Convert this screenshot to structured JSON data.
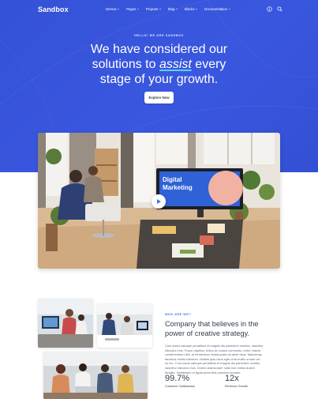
{
  "nav": {
    "logo": "Sandbox",
    "items": [
      {
        "label": "Demos"
      },
      {
        "label": "Pages"
      },
      {
        "label": "Projects"
      },
      {
        "label": "Blog"
      },
      {
        "label": "Blocks"
      },
      {
        "label": "Documentation"
      }
    ],
    "icons": [
      "info-icon",
      "search-icon"
    ]
  },
  "hero": {
    "eyebrow": "HELLO! WE ARE SANDBOX",
    "line1": "We have considered our",
    "line2_pre": "solutions to ",
    "line2_accent": "assist",
    "line2_post": " every",
    "line3": "stage of your growth.",
    "cta": "Explore Now",
    "accent_color": "#54d8e2",
    "bg_color": "#3452d6"
  },
  "video": {
    "screen_line1": "Digital",
    "screen_line2": "Marketing"
  },
  "about": {
    "eyebrow": "WHO ARE WE?",
    "title_line1": "Company that believes in the",
    "title_line2": "power of creative strategy.",
    "body_line1": "Cum sociis natoque penatibus et magnis dis parturient montes, nascetur",
    "body_line2": "ridiculus mus. Fusce dapibus, tellus ac cursus commodo, tortor mauris",
    "body_line3": "condimentum nibh, ut fermentum massa justo sit amet risus. Maecenas",
    "body_line4": "faucibus mollis interdum. Nullam quis risus eget urna mollis ornare vel",
    "body_line5": "eu leo. Cum sociis natoque penatibus et magnis dis parturient montes,",
    "body_line6": "nascetur ridiculus mus. Donec ullamcorper nulla non metus auctor",
    "body_line7": "fringilla. Vestibulum id ligula porta felis euismod semper.",
    "stats": [
      {
        "value": "99.7%",
        "label": "Customer Satisfaction"
      },
      {
        "value": "12x",
        "label": "Revenue Growth"
      }
    ]
  }
}
